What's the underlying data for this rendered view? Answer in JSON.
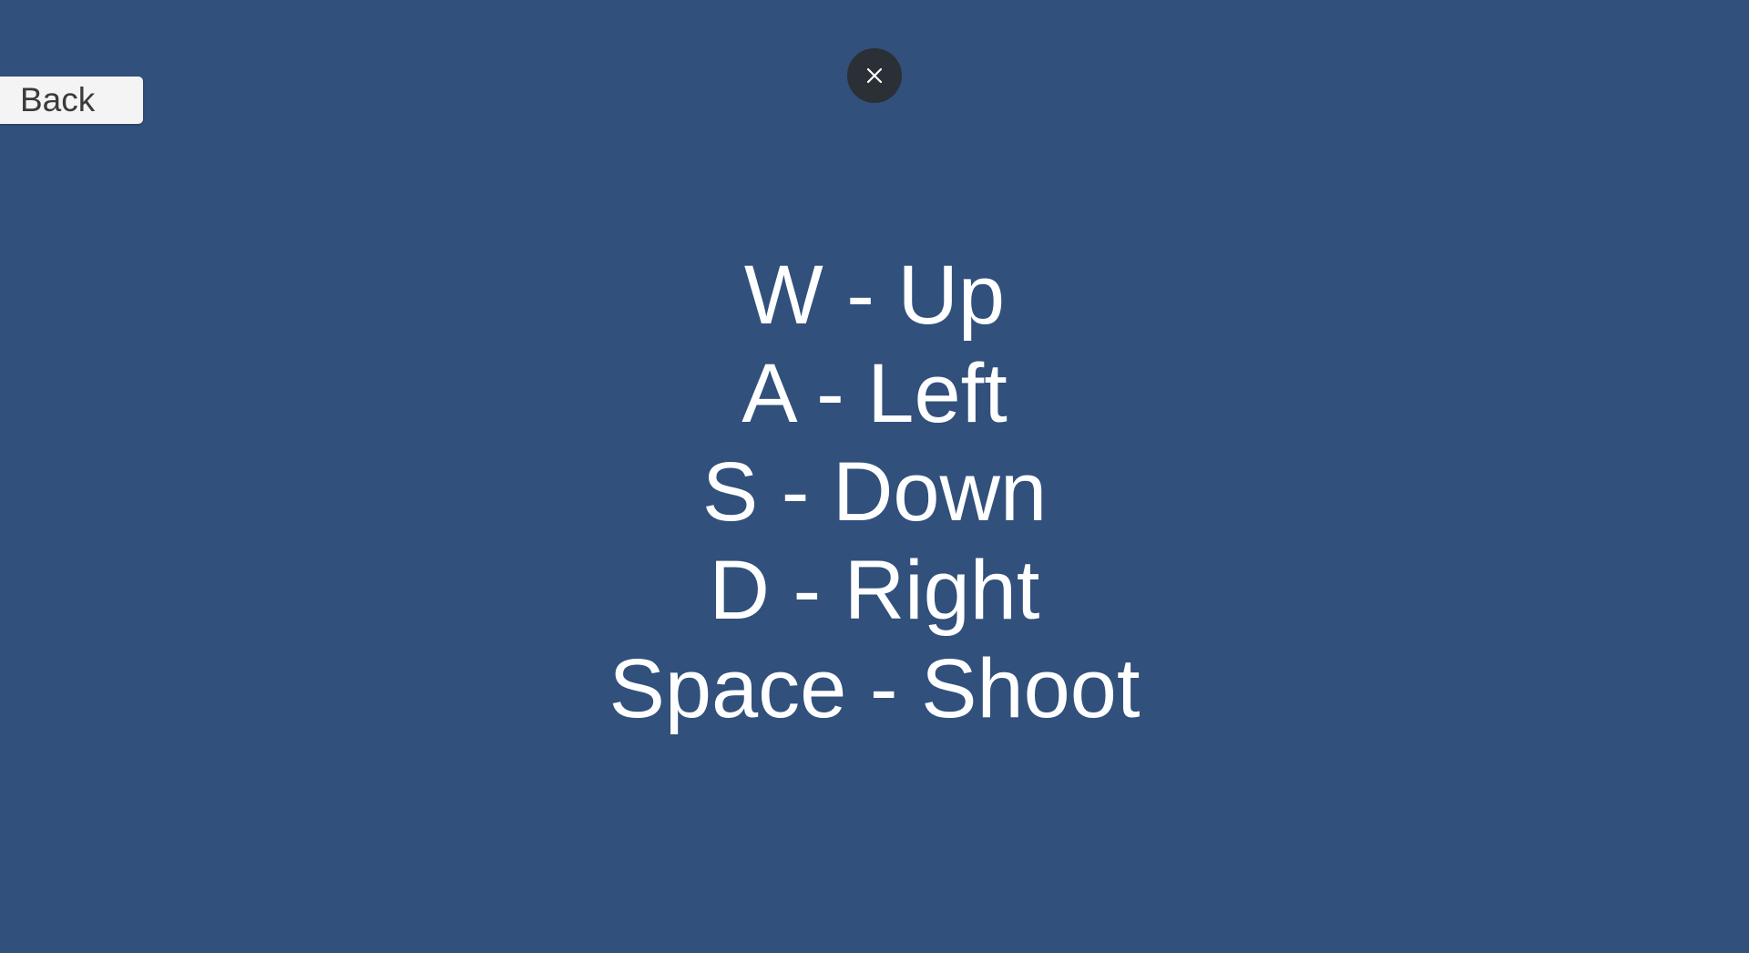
{
  "background_color": "#31507b",
  "back_button": {
    "label": "Back"
  },
  "close_button": {
    "icon": "close-icon"
  },
  "controls": [
    {
      "text": "W - Up"
    },
    {
      "text": "A - Left"
    },
    {
      "text": "S - Down"
    },
    {
      "text": "D - Right"
    },
    {
      "text": "Space - Shoot"
    }
  ]
}
